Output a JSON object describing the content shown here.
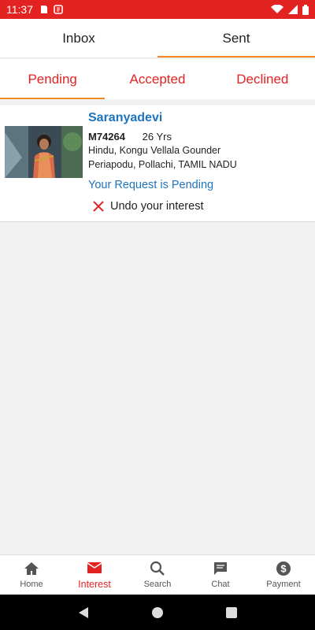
{
  "status_bar": {
    "time": "11:37"
  },
  "top_tabs": [
    {
      "label": "Inbox",
      "active": false
    },
    {
      "label": "Sent",
      "active": true
    }
  ],
  "sub_tabs": [
    {
      "label": "Pending",
      "active": true
    },
    {
      "label": "Accepted",
      "active": false
    },
    {
      "label": "Declined",
      "active": false
    }
  ],
  "profile": {
    "name": "Saranyadevi",
    "id": "M74264",
    "age": "26 Yrs",
    "religion_caste": "Hindu, Kongu Vellala Gounder",
    "location": "Periapodu, Pollachi, TAMIL NADU",
    "request_status": "Your Request is Pending",
    "undo_label": "Undo your interest"
  },
  "bottom_nav": [
    {
      "label": "Home",
      "icon": "home-icon",
      "active": false
    },
    {
      "label": "Interest",
      "icon": "mail-icon",
      "active": true
    },
    {
      "label": "Search",
      "icon": "search-icon",
      "active": false
    },
    {
      "label": "Chat",
      "icon": "chat-icon",
      "active": false
    },
    {
      "label": "Payment",
      "icon": "dollar-icon",
      "active": false
    }
  ],
  "colors": {
    "brand_red": "#e32222",
    "accent_orange": "#f08a24",
    "link_blue": "#1e73be"
  }
}
